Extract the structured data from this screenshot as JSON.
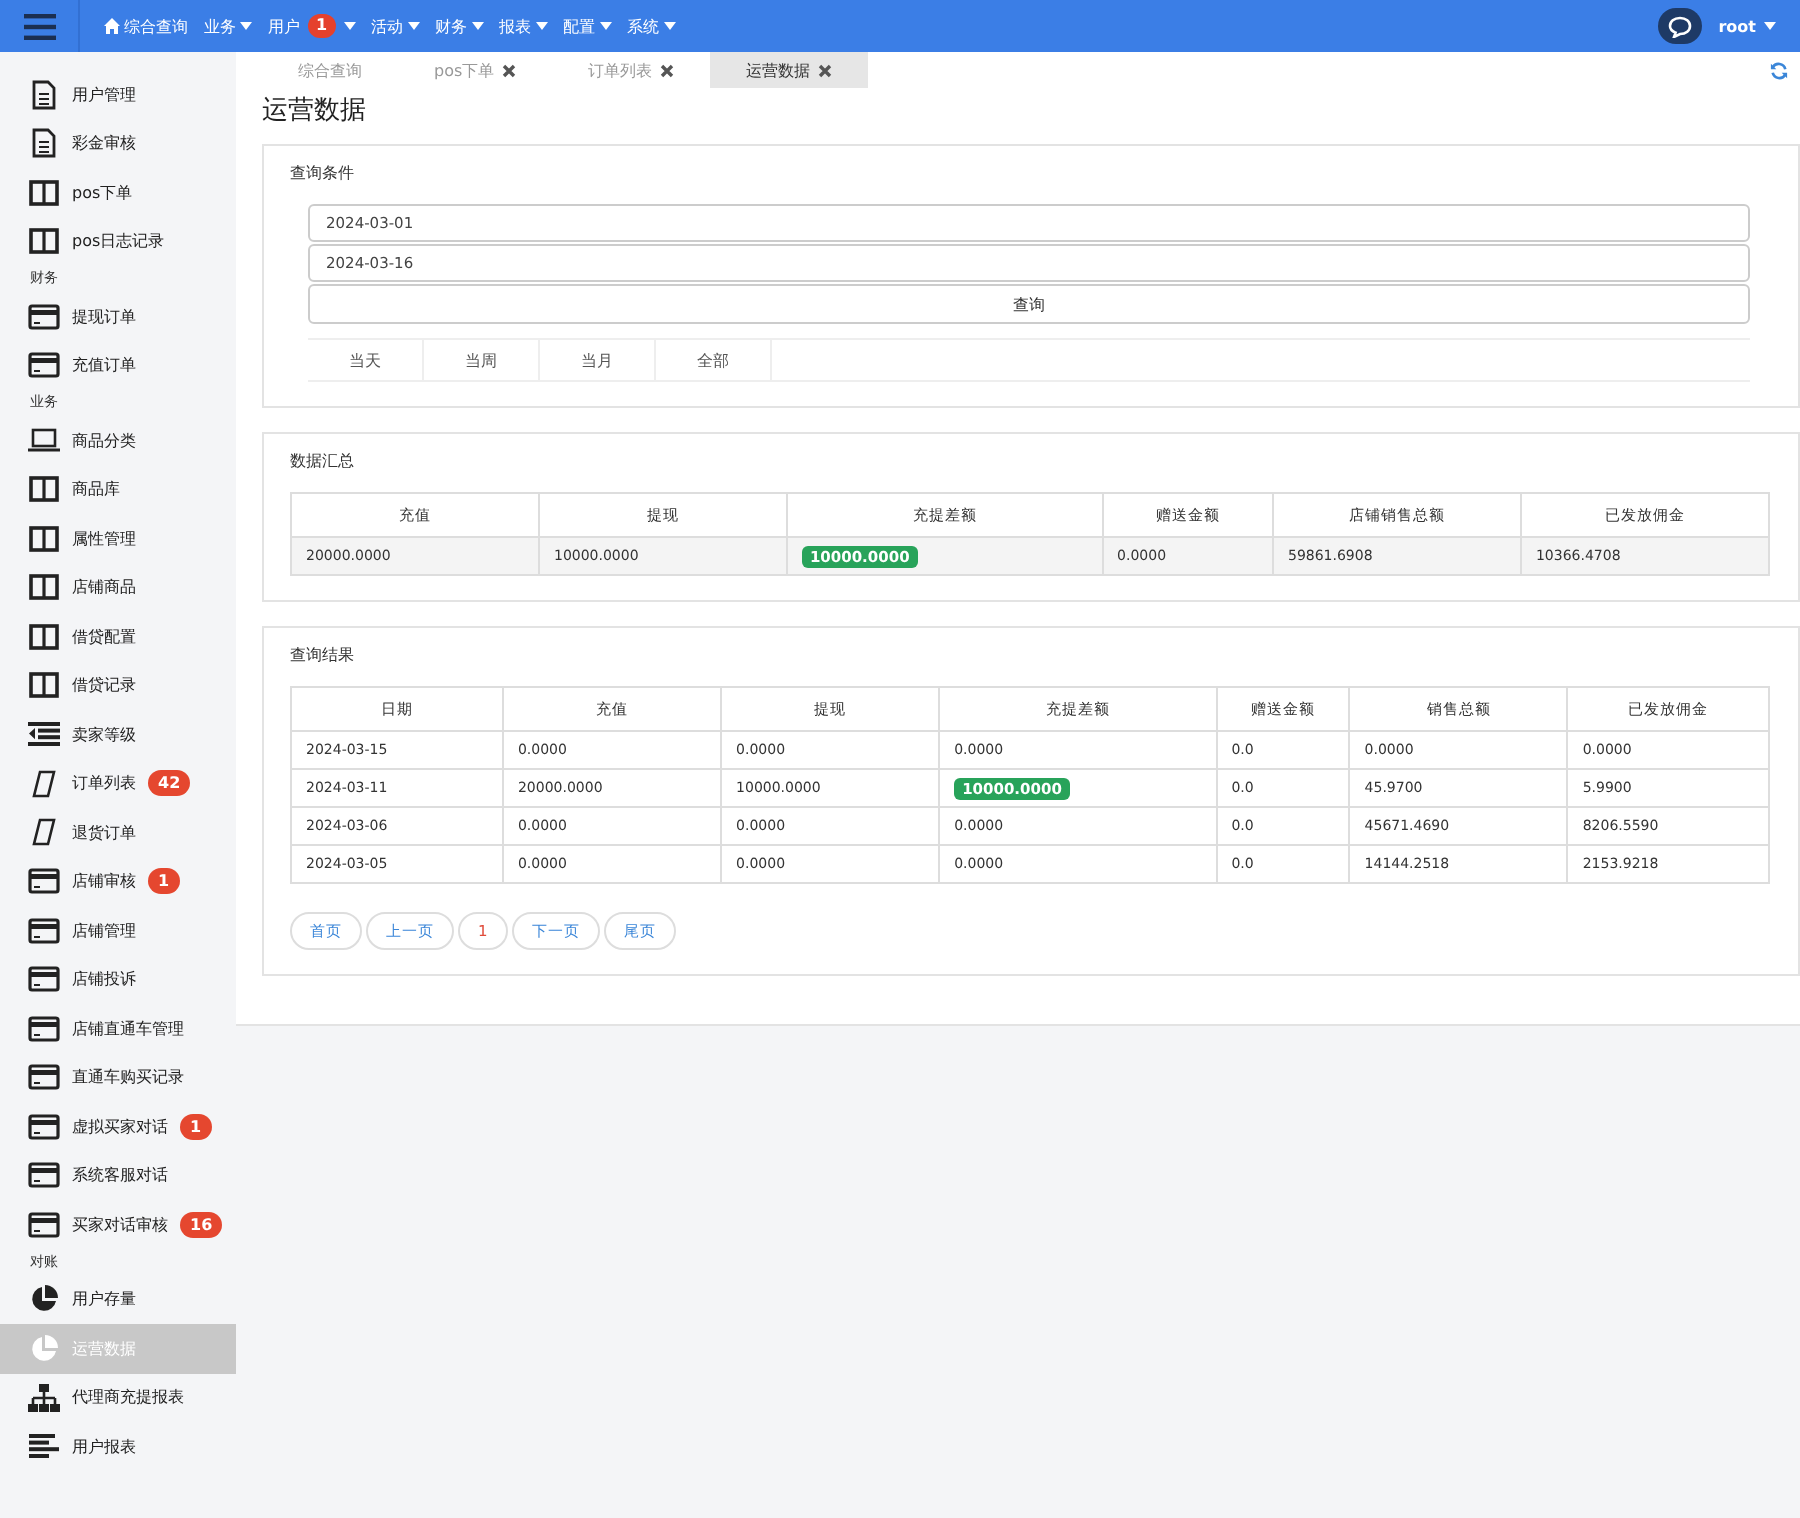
{
  "topbar": {
    "menu": [
      {
        "label": "综合查询",
        "kind": "home"
      },
      {
        "label": "业务",
        "kind": "dropdown"
      },
      {
        "label": "用户",
        "kind": "dropdown",
        "badge": "1"
      },
      {
        "label": "活动",
        "kind": "dropdown"
      },
      {
        "label": "财务",
        "kind": "dropdown"
      },
      {
        "label": "报表",
        "kind": "dropdown"
      },
      {
        "label": "配置",
        "kind": "dropdown"
      },
      {
        "label": "系统",
        "kind": "dropdown"
      }
    ],
    "user": "root"
  },
  "sidebar": {
    "groups": [
      {
        "items": [
          {
            "label": "用户管理",
            "kind": "doc",
            "selected": false
          },
          {
            "label": "彩金审核",
            "kind": "doc",
            "selected": false
          },
          {
            "label": "pos下单",
            "kind": "columns",
            "selected": false
          },
          {
            "label": "pos日志记录",
            "kind": "columns",
            "selected": false
          }
        ]
      },
      {
        "heading": "财务",
        "items": [
          {
            "label": "提现订单",
            "kind": "card",
            "selected": false
          },
          {
            "label": "充值订单",
            "kind": "card",
            "selected": false
          }
        ]
      },
      {
        "heading": "业务",
        "items": [
          {
            "label": "商品分类",
            "kind": "laptop",
            "selected": false
          },
          {
            "label": "商品库",
            "kind": "columns",
            "selected": false
          },
          {
            "label": "属性管理",
            "kind": "columns",
            "selected": false
          },
          {
            "label": "店铺商品",
            "kind": "columns",
            "selected": false
          },
          {
            "label": "借贷配置",
            "kind": "columns",
            "selected": false
          },
          {
            "label": "借贷记录",
            "kind": "columns",
            "selected": false
          },
          {
            "label": "卖家等级",
            "kind": "list",
            "selected": false
          },
          {
            "label": "订单列表",
            "kind": "phone",
            "badge": "42",
            "selected": false
          },
          {
            "label": "退货订单",
            "kind": "phone",
            "selected": false
          },
          {
            "label": "店铺审核",
            "kind": "card",
            "badge": "1",
            "selected": false
          },
          {
            "label": "店铺管理",
            "kind": "card",
            "selected": false
          },
          {
            "label": "店铺投诉",
            "kind": "card",
            "selected": false
          },
          {
            "label": "店铺直通车管理",
            "kind": "card",
            "selected": false
          },
          {
            "label": "直通车购买记录",
            "kind": "card",
            "selected": false
          },
          {
            "label": "虚拟买家对话",
            "kind": "card",
            "badge": "1",
            "selected": false
          },
          {
            "label": "系统客服对话",
            "kind": "card",
            "selected": false
          },
          {
            "label": "买家对话审核",
            "kind": "card",
            "badge": "16",
            "selected": false
          }
        ]
      },
      {
        "heading": "对账",
        "items": [
          {
            "label": "用户存量",
            "kind": "pie",
            "selected": false
          },
          {
            "label": "运营数据",
            "kind": "pie",
            "selected": true
          },
          {
            "label": "代理商充提报表",
            "kind": "sitemap",
            "selected": false
          },
          {
            "label": "用户报表",
            "kind": "bars",
            "selected": false
          }
        ]
      }
    ]
  },
  "tabs": [
    {
      "label": "综合查询",
      "closable": false,
      "selected": false
    },
    {
      "label": "pos下单",
      "closable": true,
      "selected": false
    },
    {
      "label": "订单列表",
      "closable": true,
      "selected": false
    },
    {
      "label": "运营数据",
      "closable": true,
      "selected": true
    }
  ],
  "page_title": "运营数据",
  "query": {
    "title": "查询条件",
    "start_date": "2024-03-01",
    "end_date": "2024-03-16",
    "button": "查询",
    "ranges": [
      {
        "label": "当天"
      },
      {
        "label": "当周"
      },
      {
        "label": "当月"
      },
      {
        "label": "全部"
      }
    ]
  },
  "summary": {
    "title": "数据汇总",
    "columns": [
      "充值",
      "提现",
      "充提差额",
      "赠送金额",
      "店铺销售总额",
      "已发放佣金"
    ],
    "rows": [
      [
        "20000.0000",
        "10000.0000",
        "10000.0000",
        "0.0000",
        "59861.6908",
        "10366.4708"
      ]
    ]
  },
  "results": {
    "title": "查询结果",
    "columns": [
      "日期",
      "充值",
      "提现",
      "充提差额",
      "赠送金额",
      "销售总额",
      "已发放佣金"
    ],
    "rows": [
      [
        "2024-03-15",
        "0.0000",
        "0.0000",
        "0.0000",
        "0.0",
        "0.0000",
        "0.0000"
      ],
      [
        "2024-03-11",
        "20000.0000",
        "10000.0000",
        "10000.0000",
        "0.0",
        "45.9700",
        "5.9900"
      ],
      [
        "2024-03-06",
        "0.0000",
        "0.0000",
        "0.0000",
        "0.0",
        "45671.4690",
        "8206.5590"
      ],
      [
        "2024-03-05",
        "0.0000",
        "0.0000",
        "0.0000",
        "0.0",
        "14144.2518",
        "2153.9218"
      ]
    ],
    "pagination": [
      {
        "label": "首页",
        "current": false
      },
      {
        "label": "上一页",
        "current": false
      },
      {
        "label": "1",
        "current": true
      },
      {
        "label": "下一页",
        "current": false
      },
      {
        "label": "尾页",
        "current": false
      }
    ]
  }
}
